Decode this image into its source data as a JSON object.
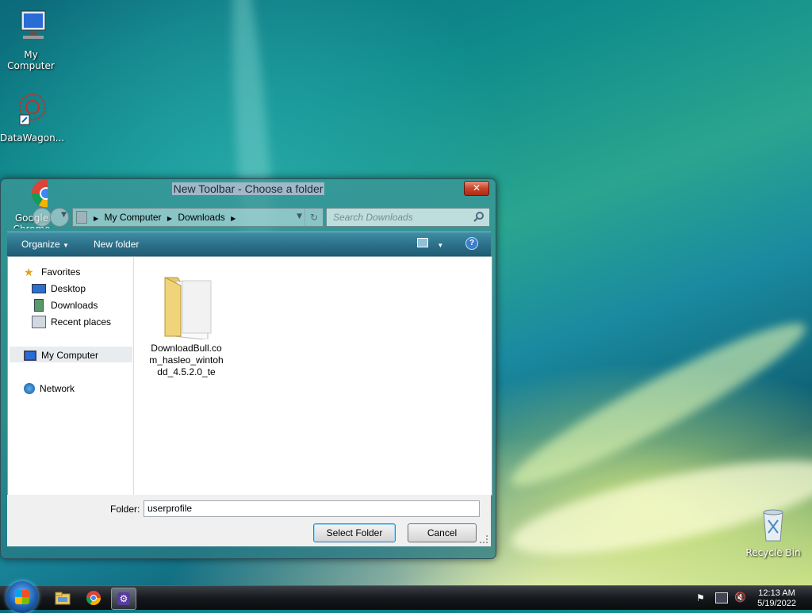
{
  "desktop": {
    "icons": [
      {
        "label": "My Computer"
      },
      {
        "label": "DataWagon..."
      },
      {
        "label": "Google Chrome"
      },
      {
        "label": "Recycle Bin"
      }
    ]
  },
  "dialog": {
    "title": "New Toolbar - Choose a folder",
    "close_label": "x",
    "address": {
      "crumbs": [
        "My Computer",
        "Downloads"
      ]
    },
    "search": {
      "placeholder": "Search Downloads"
    },
    "toolbar": {
      "organize": "Organize",
      "new_folder": "New folder"
    },
    "nav": {
      "favorites": "Favorites",
      "desktop": "Desktop",
      "downloads": "Downloads",
      "recent": "Recent places",
      "computer": "My Computer",
      "network": "Network"
    },
    "files": [
      {
        "name": "DownloadBull.com_hasleo_wintohdd_4.5.2.0_te"
      }
    ],
    "folder_label": "Folder:",
    "folder_value": "userprofile",
    "select_button": "Select Folder",
    "cancel_button": "Cancel"
  },
  "taskbar": {
    "time": "12:13 AM",
    "date": "5/19/2022"
  },
  "colors": {
    "toolbar": "#2b6f88",
    "close": "#c8452a",
    "selection": "#e9ecef"
  }
}
